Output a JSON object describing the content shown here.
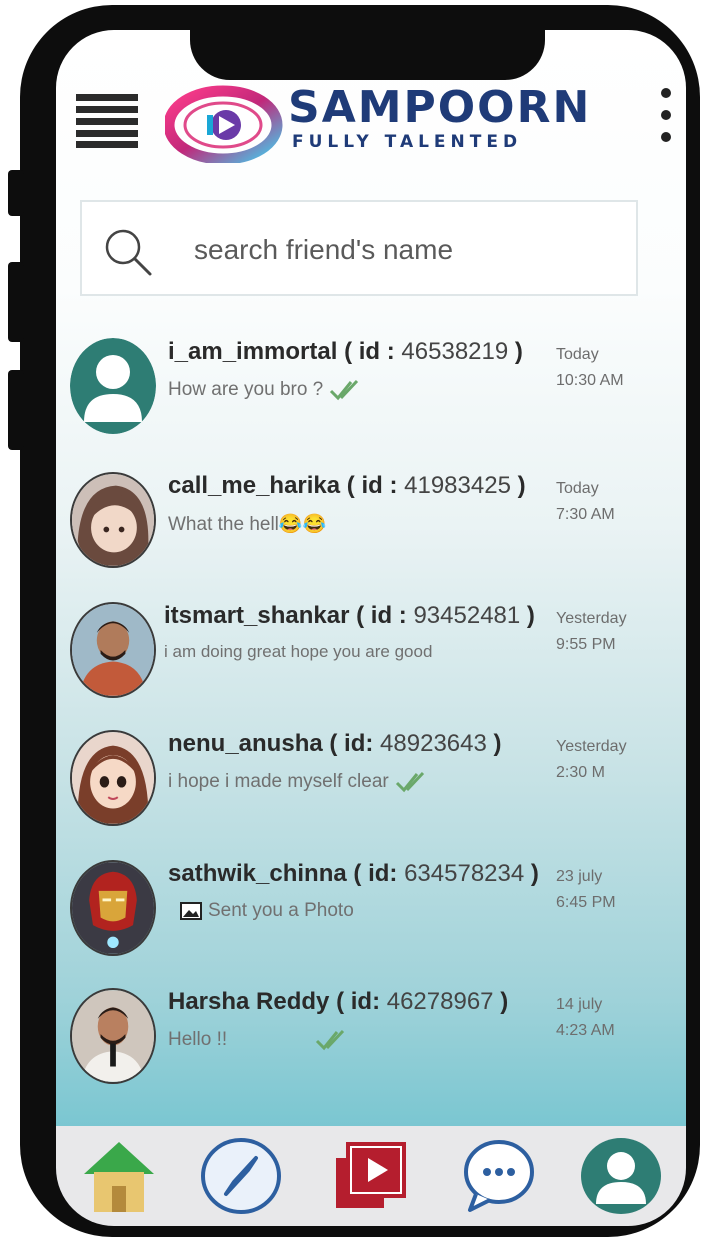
{
  "brand": {
    "name": "SAMPOORN",
    "tagline": "FULLY TALENTED"
  },
  "search": {
    "placeholder": "search friend's name"
  },
  "chats": [
    {
      "name": "i_am_immortal",
      "id_label": "id :",
      "id": "46538219",
      "preview": "How are you bro ?",
      "read_tick": true,
      "time_day": "Today",
      "time_clock": "10:30 AM",
      "avatar": "default-avatar"
    },
    {
      "name": "call_me_harika",
      "id_label": "id :",
      "id": "41983425",
      "preview": "What the hell",
      "emoji": "😂😂",
      "time_day": "Today",
      "time_clock": "7:30 AM",
      "avatar": "anime-girl-photo"
    },
    {
      "name": "itsmart_shankar",
      "id_label": "id :",
      "id": "93452481",
      "preview": "i am doing great hope you are good",
      "time_day": "Yesterday",
      "time_clock": "9:55 PM",
      "avatar": "man-photo"
    },
    {
      "name": "nenu_anusha",
      "id_label": "id:",
      "id": "48923643",
      "preview": "i hope i made myself clear",
      "read_tick": true,
      "time_day": "Yesterday",
      "time_clock": "2:30 M",
      "avatar": "cartoon-girl-photo"
    },
    {
      "name": "sathwik_chinna",
      "id_label": "id:",
      "id": "634578234",
      "preview": "Sent you a Photo",
      "photo_icon": true,
      "time_day": "23 july",
      "time_clock": "6:45 PM",
      "avatar": "ironman-photo"
    },
    {
      "name": "Harsha Reddy",
      "id_label": "id:",
      "id": "46278967",
      "preview": "Hello !!",
      "read_tick": true,
      "time_day": "14 july",
      "time_clock": "4:23 AM",
      "avatar": "man-with-mic-photo"
    }
  ],
  "nav": [
    "home-icon",
    "compass-icon",
    "video-library-icon",
    "chat-bubble-icon",
    "profile-icon"
  ],
  "colors": {
    "accent": "#2e7d74",
    "brand": "#1f3b78",
    "tick": "#6aa86a",
    "video_red": "#b51e2e"
  }
}
